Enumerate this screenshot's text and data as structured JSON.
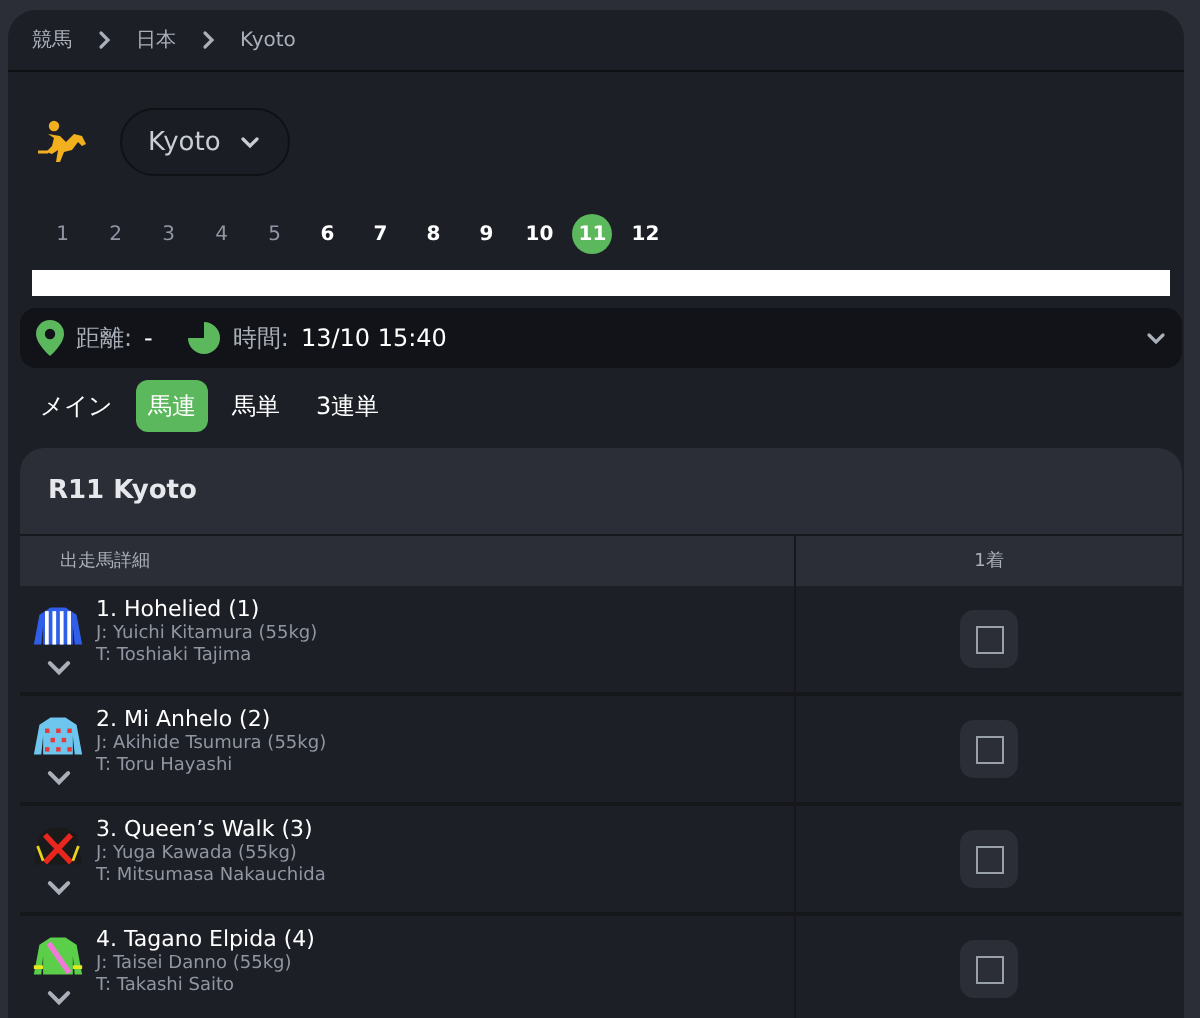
{
  "breadcrumb": [
    "競馬",
    "日本",
    "Kyoto"
  ],
  "venue": {
    "value": "Kyoto"
  },
  "races": [
    {
      "label": "1",
      "finished": true,
      "selected": false
    },
    {
      "label": "2",
      "finished": true,
      "selected": false
    },
    {
      "label": "3",
      "finished": true,
      "selected": false
    },
    {
      "label": "4",
      "finished": true,
      "selected": false
    },
    {
      "label": "5",
      "finished": true,
      "selected": false
    },
    {
      "label": "6",
      "finished": false,
      "selected": false
    },
    {
      "label": "7",
      "finished": false,
      "selected": false
    },
    {
      "label": "8",
      "finished": false,
      "selected": false
    },
    {
      "label": "9",
      "finished": false,
      "selected": false
    },
    {
      "label": "10",
      "finished": false,
      "selected": false
    },
    {
      "label": "11",
      "finished": false,
      "selected": true
    },
    {
      "label": "12",
      "finished": false,
      "selected": false
    }
  ],
  "info": {
    "distance_label": "距離:",
    "distance": "-",
    "time_label": "時間:",
    "time": "13/10 15:40"
  },
  "tabs": [
    {
      "label": "メイン",
      "selected": false
    },
    {
      "label": "馬連",
      "selected": true
    },
    {
      "label": "馬単",
      "selected": false
    },
    {
      "label": "3連単",
      "selected": false
    }
  ],
  "race_card": {
    "title": "R11 Kyoto",
    "columns": [
      "出走馬詳細",
      "1着"
    ],
    "runners": [
      {
        "name": "1. Hohelied (1)",
        "jockey": "J: Yuichi Kitamura (55kg)",
        "trainer": "T: Toshiaki Tajima",
        "silk": {
          "kind": "stripes",
          "color": "#2f5fe8"
        },
        "checked": false
      },
      {
        "name": "2. Mi Anhelo (2)",
        "jockey": "J: Akihide Tsumura (55kg)",
        "trainer": "T: Toru Hayashi",
        "silk": {
          "kind": "dots",
          "color": "#6ec6ee"
        },
        "checked": false
      },
      {
        "name": "3. Queen’s Walk (3)",
        "jockey": "J: Yuga Kawada (55kg)",
        "trainer": "T: Mitsumasa Nakauchida",
        "silk": {
          "kind": "cross",
          "color": "#1a1a1a"
        },
        "checked": false
      },
      {
        "name": "4. Tagano Elpida (4)",
        "jockey": "J: Taisei Danno (55kg)",
        "trainer": "T: Takashi Saito",
        "silk": {
          "kind": "sash",
          "color": "#5ccf4a"
        },
        "checked": false
      }
    ]
  }
}
